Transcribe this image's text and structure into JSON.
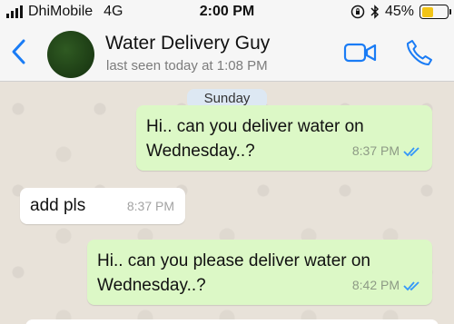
{
  "status_bar": {
    "carrier": "DhiMobile",
    "network": "4G",
    "time": "2:00 PM",
    "battery_percent": "45%",
    "battery_level": 0.45,
    "battery_color": "#f2c416"
  },
  "header": {
    "contact_name": "Water Delivery Guy",
    "last_seen": "last seen today at 1:08 PM",
    "accent": "#1a7cf5"
  },
  "chat": {
    "date_label": "Sunday",
    "messages": [
      {
        "direction": "outgoing",
        "line1": "Hi.. can you deliver water on",
        "line2": "Wednesday..?",
        "time": "8:37 PM",
        "status": "read"
      },
      {
        "direction": "incoming",
        "text": "add pls",
        "time": "8:37 PM"
      },
      {
        "direction": "outgoing",
        "line1": "Hi.. can you please deliver water on",
        "line2": "Wednesday..?",
        "time": "8:42 PM",
        "status": "read"
      }
    ]
  }
}
